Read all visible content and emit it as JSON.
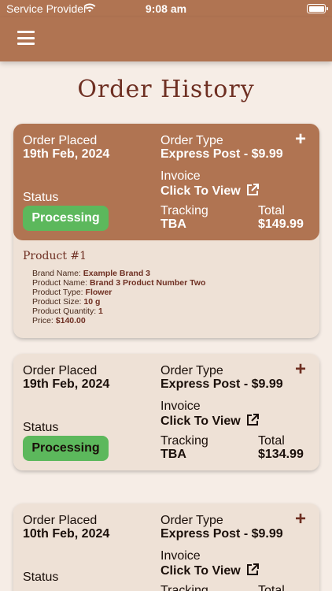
{
  "status_bar": {
    "carrier": "Service Provider",
    "time": "9:08 am"
  },
  "navbar": {
    "menu_icon": "hamburger-menu-icon"
  },
  "page": {
    "title": "Order History"
  },
  "labels": {
    "order_placed": "Order Placed",
    "order_type": "Order Type",
    "invoice": "Invoice",
    "click_to_view": "Click To View",
    "status": "Status",
    "tracking": "Tracking",
    "total": "Total",
    "expand_symbol": "+"
  },
  "orders": [
    {
      "date": "19th Feb, 2024",
      "type": "Express Post - $9.99",
      "status": "Processing",
      "tracking": "TBA",
      "total": "$149.99",
      "expanded": true,
      "product": {
        "title": "Product #1",
        "brand_label": "Brand Name:",
        "brand": "Example Brand 3",
        "name_label": "Product Name:",
        "name": "Brand 3 Product Number Two",
        "type_label": "Product Type:",
        "type": "Flower",
        "size_label": "Product Size:",
        "size": "10 g",
        "qty_label": "Product Quantity:",
        "qty": "1",
        "price_label": "Price:",
        "price": "$140.00"
      }
    },
    {
      "date": "19th Feb, 2024",
      "type": "Express Post - $9.99",
      "status": "Processing",
      "tracking": "TBA",
      "total": "$134.99",
      "expanded": false
    },
    {
      "date": "10th Feb, 2024",
      "type": "Express Post - $9.99",
      "status": "",
      "tracking": "",
      "total": "",
      "expanded": false
    }
  ],
  "colors": {
    "brand": "#b07452",
    "background": "#f6ede6",
    "card": "#eee1d6",
    "title": "#6e2f22",
    "status_processing": "#5cb85c"
  },
  "icons": {
    "wifi": "wifi-icon",
    "battery": "battery-icon",
    "external_link": "external-link-icon",
    "expand": "plus-icon"
  }
}
